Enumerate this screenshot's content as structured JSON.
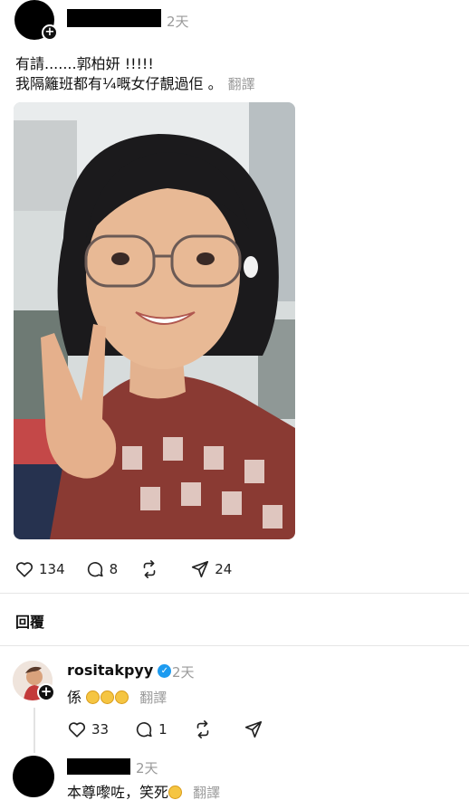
{
  "post": {
    "time": "2天",
    "line1": "有請.......郭柏妍 !!!!!",
    "line2": "我隔籬班都有¼嘅女仔靚過佢 。",
    "translate": "翻譯",
    "likes": "134",
    "comments": "8",
    "shares": "24"
  },
  "replies_title": "回覆",
  "reply1": {
    "username": "rositakpyy",
    "time": "2天",
    "text": "係",
    "translate": "翻譯",
    "likes": "33",
    "comments": "1"
  },
  "reply2": {
    "time": "2天",
    "text": "本尊嚟咗，笑死",
    "translate": "翻譯"
  },
  "icons": {
    "verified": "✓",
    "plus": "+"
  }
}
